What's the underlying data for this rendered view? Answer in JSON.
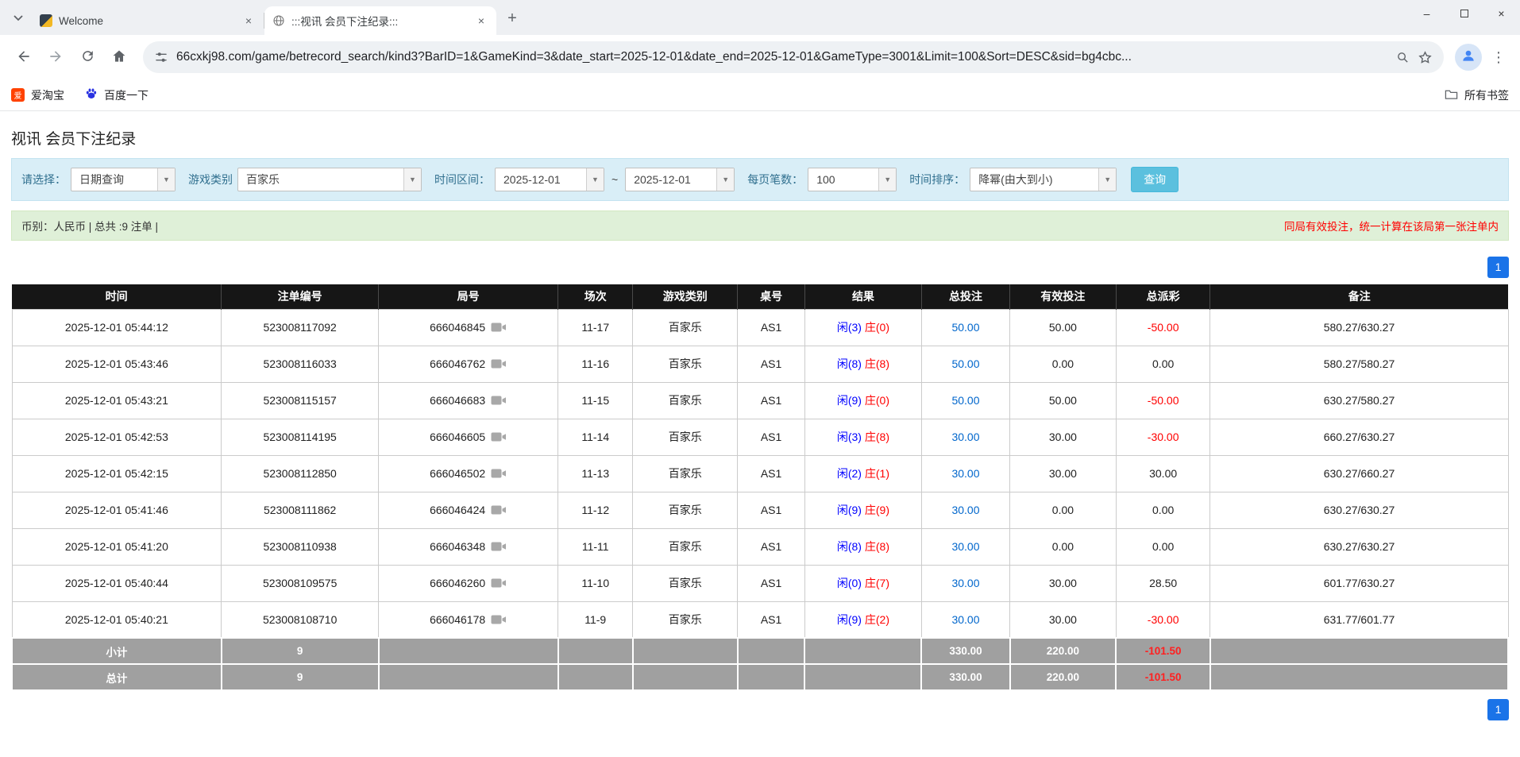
{
  "colors": {
    "header_bg": "#161616",
    "summary_bg": "#a0a0a0",
    "link_blue": "#0066cc",
    "player_blue": "#0000ff",
    "banker_red": "#ff0000",
    "neg_red": "#ff0000",
    "pager_blue": "#1a73e8"
  },
  "browser": {
    "tabs": [
      {
        "title": "Welcome"
      },
      {
        "title": ":::视讯 会员下注纪录:::"
      }
    ],
    "url": "66cxkj98.com/game/betrecord_search/kind3?BarID=1&GameKind=3&date_start=2025-12-01&date_end=2025-12-01&GameType=3001&Limit=100&Sort=DESC&sid=bg4cbc...",
    "bookmarks": [
      {
        "label": "爱淘宝"
      },
      {
        "label": "百度一下"
      }
    ],
    "all_bookmarks_label": "所有书签"
  },
  "page": {
    "title": "视讯 会员下注纪录",
    "filters": {
      "select_label": "请选择：",
      "select_value": "日期查询",
      "game_label": "游戏类别",
      "game_value": "百家乐",
      "range_label": "时间区间：",
      "date_start": "2025-12-01",
      "tilde": "~",
      "date_end": "2025-12-01",
      "per_page_label": "每页笔数：",
      "per_page_value": "100",
      "sort_label": "时间排序：",
      "sort_value": "降幂(由大到小)",
      "search_button": "查询"
    },
    "info_bar": {
      "left": "币别：人民币 | 总共 :9 注单 |",
      "right": "同局有效投注，统一计算在该局第一张注单内"
    },
    "pagination": "1"
  },
  "table": {
    "headers": [
      "时间",
      "注单编号",
      "局号",
      "场次",
      "游戏类别",
      "桌号",
      "结果",
      "总投注",
      "有效投注",
      "总派彩",
      "备注"
    ],
    "rows": [
      {
        "time": "2025-12-01 05:44:12",
        "bet_id": "523008117092",
        "round_id": "666046845",
        "session": "11-17",
        "game_type": "百家乐",
        "table_no": "AS1",
        "result_player": "闲(3)",
        "result_banker": "庄(0)",
        "total_bet": "50.00",
        "valid_bet": "50.00",
        "payout": "-50.00",
        "note": "580.27/630.27"
      },
      {
        "time": "2025-12-01 05:43:46",
        "bet_id": "523008116033",
        "round_id": "666046762",
        "session": "11-16",
        "game_type": "百家乐",
        "table_no": "AS1",
        "result_player": "闲(8)",
        "result_banker": "庄(8)",
        "total_bet": "50.00",
        "valid_bet": "0.00",
        "payout": "0.00",
        "note": "580.27/580.27"
      },
      {
        "time": "2025-12-01 05:43:21",
        "bet_id": "523008115157",
        "round_id": "666046683",
        "session": "11-15",
        "game_type": "百家乐",
        "table_no": "AS1",
        "result_player": "闲(9)",
        "result_banker": "庄(0)",
        "total_bet": "50.00",
        "valid_bet": "50.00",
        "payout": "-50.00",
        "note": "630.27/580.27"
      },
      {
        "time": "2025-12-01 05:42:53",
        "bet_id": "523008114195",
        "round_id": "666046605",
        "session": "11-14",
        "game_type": "百家乐",
        "table_no": "AS1",
        "result_player": "闲(3)",
        "result_banker": "庄(8)",
        "total_bet": "30.00",
        "valid_bet": "30.00",
        "payout": "-30.00",
        "note": "660.27/630.27"
      },
      {
        "time": "2025-12-01 05:42:15",
        "bet_id": "523008112850",
        "round_id": "666046502",
        "session": "11-13",
        "game_type": "百家乐",
        "table_no": "AS1",
        "result_player": "闲(2)",
        "result_banker": "庄(1)",
        "total_bet": "30.00",
        "valid_bet": "30.00",
        "payout": "30.00",
        "note": "630.27/660.27"
      },
      {
        "time": "2025-12-01 05:41:46",
        "bet_id": "523008111862",
        "round_id": "666046424",
        "session": "11-12",
        "game_type": "百家乐",
        "table_no": "AS1",
        "result_player": "闲(9)",
        "result_banker": "庄(9)",
        "total_bet": "30.00",
        "valid_bet": "0.00",
        "payout": "0.00",
        "note": "630.27/630.27"
      },
      {
        "time": "2025-12-01 05:41:20",
        "bet_id": "523008110938",
        "round_id": "666046348",
        "session": "11-11",
        "game_type": "百家乐",
        "table_no": "AS1",
        "result_player": "闲(8)",
        "result_banker": "庄(8)",
        "total_bet": "30.00",
        "valid_bet": "0.00",
        "payout": "0.00",
        "note": "630.27/630.27"
      },
      {
        "time": "2025-12-01 05:40:44",
        "bet_id": "523008109575",
        "round_id": "666046260",
        "session": "11-10",
        "game_type": "百家乐",
        "table_no": "AS1",
        "result_player": "闲(0)",
        "result_banker": "庄(7)",
        "total_bet": "30.00",
        "valid_bet": "30.00",
        "payout": "28.50",
        "note": "601.77/630.27"
      },
      {
        "time": "2025-12-01 05:40:21",
        "bet_id": "523008108710",
        "round_id": "666046178",
        "session": "11-9",
        "game_type": "百家乐",
        "table_no": "AS1",
        "result_player": "闲(9)",
        "result_banker": "庄(2)",
        "total_bet": "30.00",
        "valid_bet": "30.00",
        "payout": "-30.00",
        "note": "631.77/601.77"
      }
    ],
    "subtotal": {
      "label": "小计",
      "count": "9",
      "total_bet": "330.00",
      "valid_bet": "220.00",
      "payout": "-101.50"
    },
    "total": {
      "label": "总计",
      "count": "9",
      "total_bet": "330.00",
      "valid_bet": "220.00",
      "payout": "-101.50"
    }
  }
}
